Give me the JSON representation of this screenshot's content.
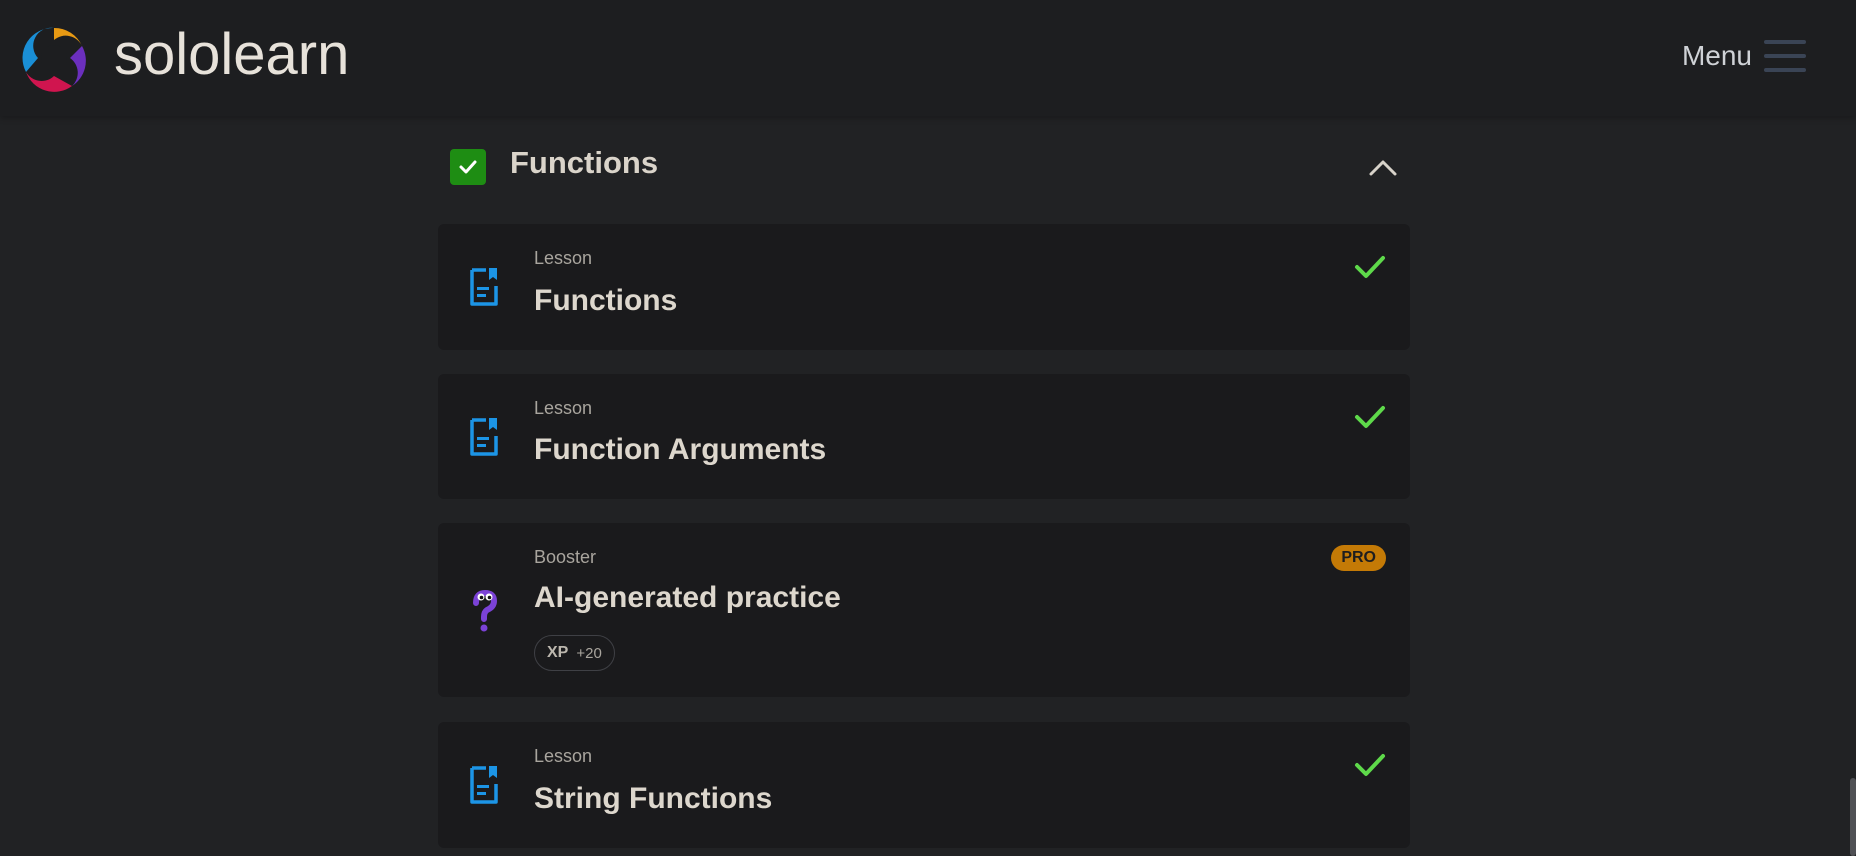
{
  "brand": {
    "name": "sololearn",
    "colors": {
      "blue": "#1a8fd6",
      "orange": "#e89a13",
      "magenta": "#d0154f",
      "purple": "#6b2fbe"
    }
  },
  "header": {
    "menu_label": "Menu",
    "menu_icon": "hamburger-icon"
  },
  "section": {
    "title": "Functions",
    "completed": true,
    "expanded": true,
    "check_color": "#1e8d13"
  },
  "items": [
    {
      "kind": "Lesson",
      "title": "Functions",
      "icon": "lesson-doc-icon",
      "completed": true
    },
    {
      "kind": "Lesson",
      "title": "Function Arguments",
      "icon": "lesson-doc-icon",
      "completed": true
    },
    {
      "kind": "Booster",
      "title": "AI-generated practice",
      "icon": "question-mark-icon",
      "badge": "PRO",
      "xp_label": "XP",
      "xp_value": "+20"
    },
    {
      "kind": "Lesson",
      "title": "String Functions",
      "icon": "lesson-doc-icon",
      "completed": true
    }
  ],
  "colors": {
    "background": "#212224",
    "card": "#1a1a1c",
    "done_check": "#5ed94a",
    "lesson_icon": "#1c95e6",
    "pro_badge": "#c47a06",
    "booster_icon": "#7b42d6"
  }
}
